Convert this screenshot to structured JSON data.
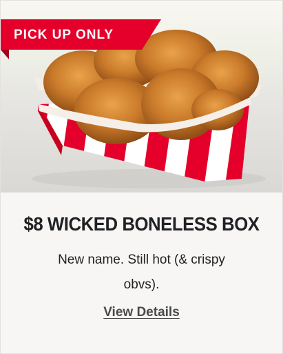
{
  "badge": {
    "label": "PICK UP ONLY"
  },
  "product": {
    "image_alt": "Boneless fried chicken pieces in a red and white striped box",
    "title": "$8 WICKED BONELESS BOX",
    "description": "New name. Still hot (& crispy obvs).",
    "details_link": "View Details"
  },
  "colors": {
    "brand_red": "#e4002b",
    "text_dark": "#202124",
    "card_bg": "#f7f6f4"
  }
}
